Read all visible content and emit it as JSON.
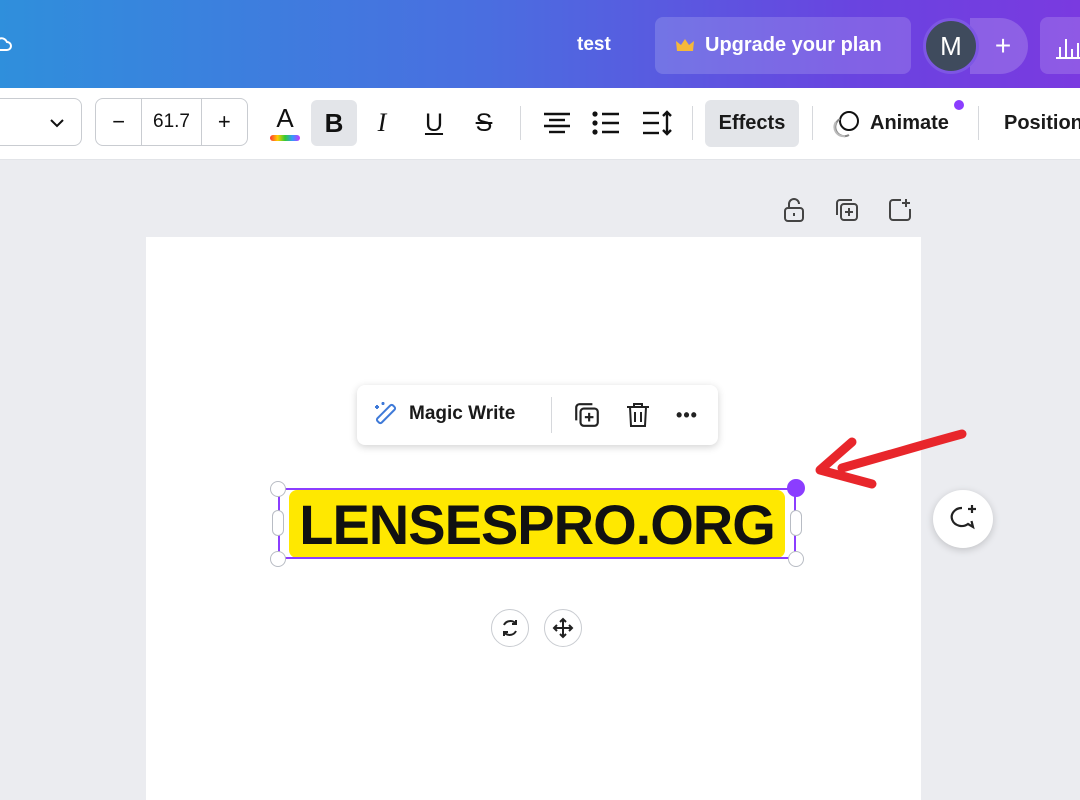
{
  "header": {
    "doc_title": "test",
    "upgrade_label": "Upgrade your plan",
    "avatar_initial": "M",
    "add_icon_glyph": "+",
    "icons": [
      "cloud-sync-icon",
      "crown-icon",
      "plus-icon",
      "insights-icon"
    ]
  },
  "toolbar": {
    "font_size": "61.7",
    "decrease_glyph": "−",
    "increase_glyph": "+",
    "text_color_glyph": "A",
    "bold_glyph": "B",
    "italic_glyph": "I",
    "underline_glyph": "U",
    "strike_glyph": "S",
    "effects_label": "Effects",
    "animate_label": "Animate",
    "position_label": "Position",
    "accent_color": "#8b3dff"
  },
  "context_menu": {
    "magic_write_label": "Magic Write",
    "more_glyph": "•••"
  },
  "canvas": {
    "headline_text": "LENSESPRO.ORG",
    "highlight_color": "#ffe800"
  },
  "colors": {
    "gradient_start": "#2f8fdc",
    "gradient_end": "#7a3ae0",
    "selection": "#8b3dff",
    "arrow": "#e8262b"
  }
}
